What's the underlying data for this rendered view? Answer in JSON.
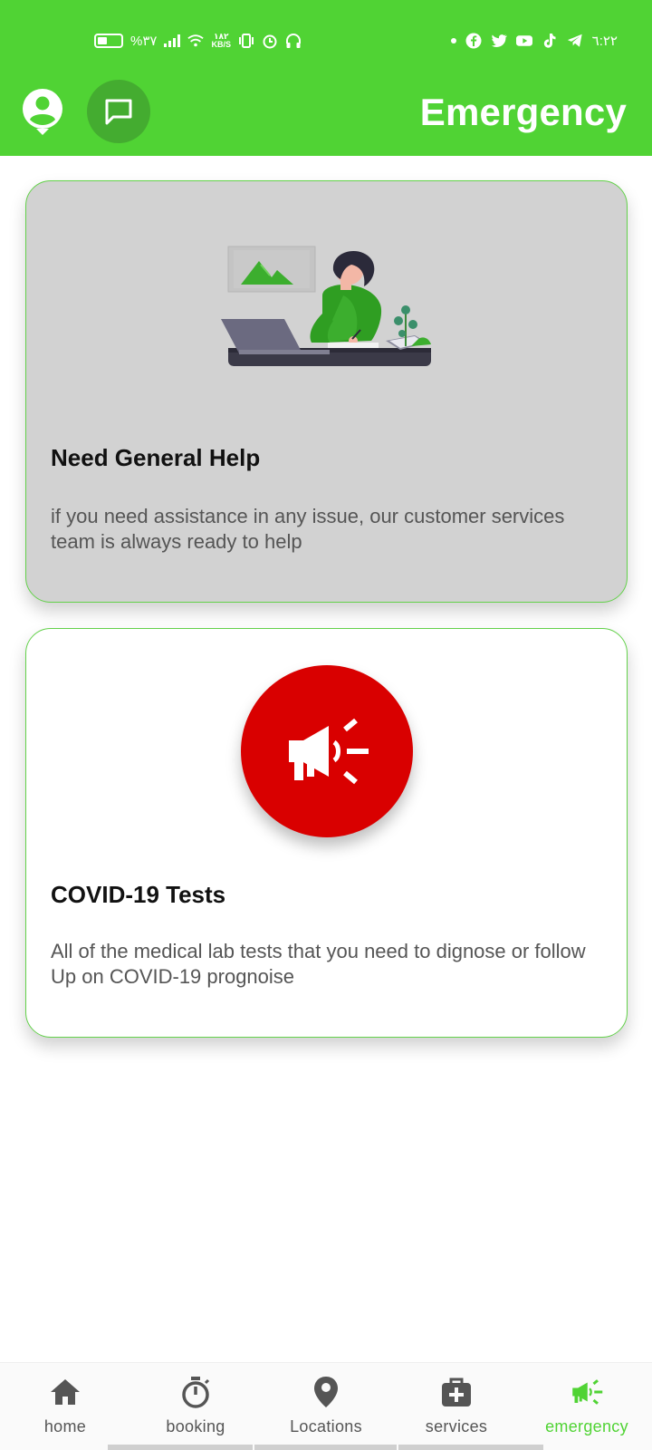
{
  "status_bar": {
    "battery_percent": "%٣٧",
    "speed_value": "١٨٢",
    "speed_unit": "KB/S",
    "time": "٦:٢٢"
  },
  "app_bar": {
    "title": "Emergency",
    "profile_icon": "account-circle-icon",
    "chat_icon": "chat-bubble-icon"
  },
  "cards": [
    {
      "title": "Need General Help",
      "description": "if you need assistance in any issue, our customer services team is always ready to help",
      "illustration": "woman-at-desk-illustration"
    },
    {
      "title": "COVID-19 Tests",
      "description": "All of the medical lab tests that you need to dignose or follow Up on COVID-19 prognoise",
      "icon": "megaphone-icon"
    }
  ],
  "bottom_nav": {
    "active": "emergency",
    "items": [
      {
        "id": "home",
        "label": "home",
        "icon": "home-icon"
      },
      {
        "id": "booking",
        "label": "booking",
        "icon": "stopwatch-icon"
      },
      {
        "id": "locations",
        "label": "Locations",
        "icon": "map-pin-icon"
      },
      {
        "id": "services",
        "label": "services",
        "icon": "medical-kit-icon"
      },
      {
        "id": "emergency",
        "label": "emergency",
        "icon": "megaphone-icon"
      }
    ]
  },
  "colors": {
    "brand_green": "#50d334",
    "alert_red": "#d90000",
    "card_gray": "#d2d2d2"
  }
}
